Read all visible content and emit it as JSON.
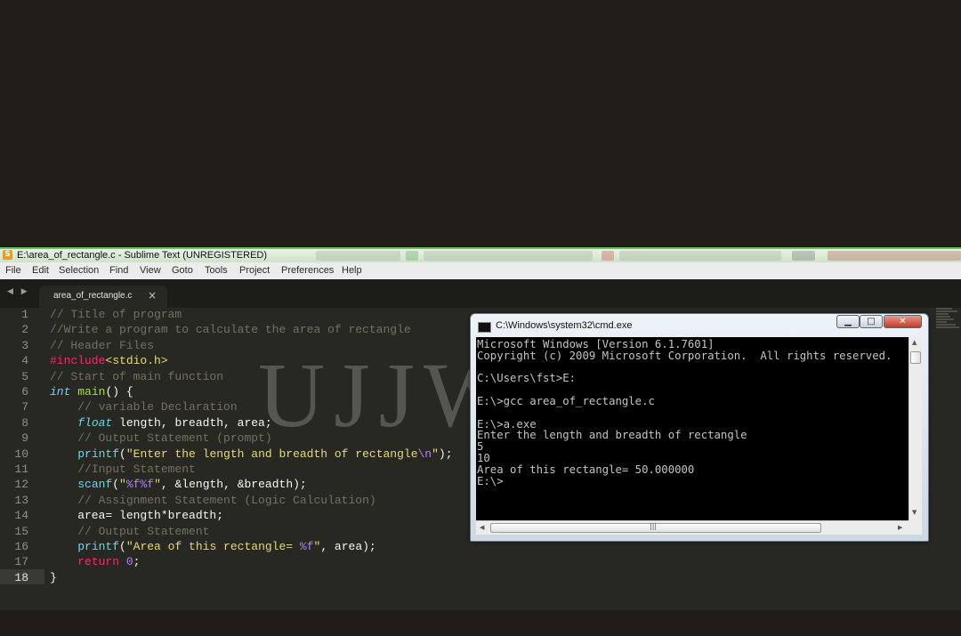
{
  "window": {
    "title": "E:\\area_of_rectangle.c - Sublime Text (UNREGISTERED)",
    "app_icon_glyph": "S"
  },
  "menu": [
    "File",
    "Edit",
    "Selection",
    "Find",
    "View",
    "Goto",
    "Tools",
    "Project",
    "Preferences",
    "Help"
  ],
  "tabs": {
    "nav_arrows": "◀ ▶",
    "active": "area_of_rectangle.c",
    "close": "×"
  },
  "editor": {
    "line_numbers": [
      "1",
      "2",
      "3",
      "4",
      "5",
      "6",
      "7",
      "8",
      "9",
      "10",
      "11",
      "12",
      "13",
      "14",
      "15",
      "16",
      "17",
      "18"
    ],
    "active_line": "18",
    "lines": [
      "// Title of program",
      "//Write a program to calculate the area of rectangle",
      "// Header Files",
      "#include<stdio.h>",
      "// Start of main function",
      "int main() {",
      "    // variable Declaration",
      "    float length, breadth, area;",
      "    // Output Statement (prompt)",
      "    printf(\"Enter the length and breadth of rectangle\\n\");",
      "    //Input Statement",
      "    scanf(\"%f%f\", &length, &breadth);",
      "    // Assignment Statement (Logic Calculation)",
      "    area= length*breadth;",
      "    // Output Statement",
      "    printf(\"Area of this rectangle= %f\", area);",
      "    return 0;",
      "}"
    ]
  },
  "watermark": "UJJWAL",
  "cmd": {
    "title": "C:\\Windows\\system32\\cmd.exe",
    "minimize": "▁",
    "maximize": "□",
    "close": "✕",
    "hscroll_grip": "|||",
    "lines": [
      "Microsoft Windows [Version 6.1.7601]",
      "Copyright (c) 2009 Microsoft Corporation.  All rights reserved.",
      "",
      "C:\\Users\\fst>E:",
      "",
      "E:\\>gcc area_of_rectangle.c",
      "",
      "E:\\>a.exe",
      "Enter the length and breadth of rectangle",
      "5",
      "10",
      "Area of this rectangle= 50.000000",
      "E:\\>"
    ]
  },
  "colors": {
    "editor_bg": "#272822",
    "comment": "#75715e",
    "keyword": "#f92672",
    "type": "#66d9ef",
    "function": "#a6e22e",
    "string": "#e6db74",
    "constant": "#ae81ff"
  }
}
